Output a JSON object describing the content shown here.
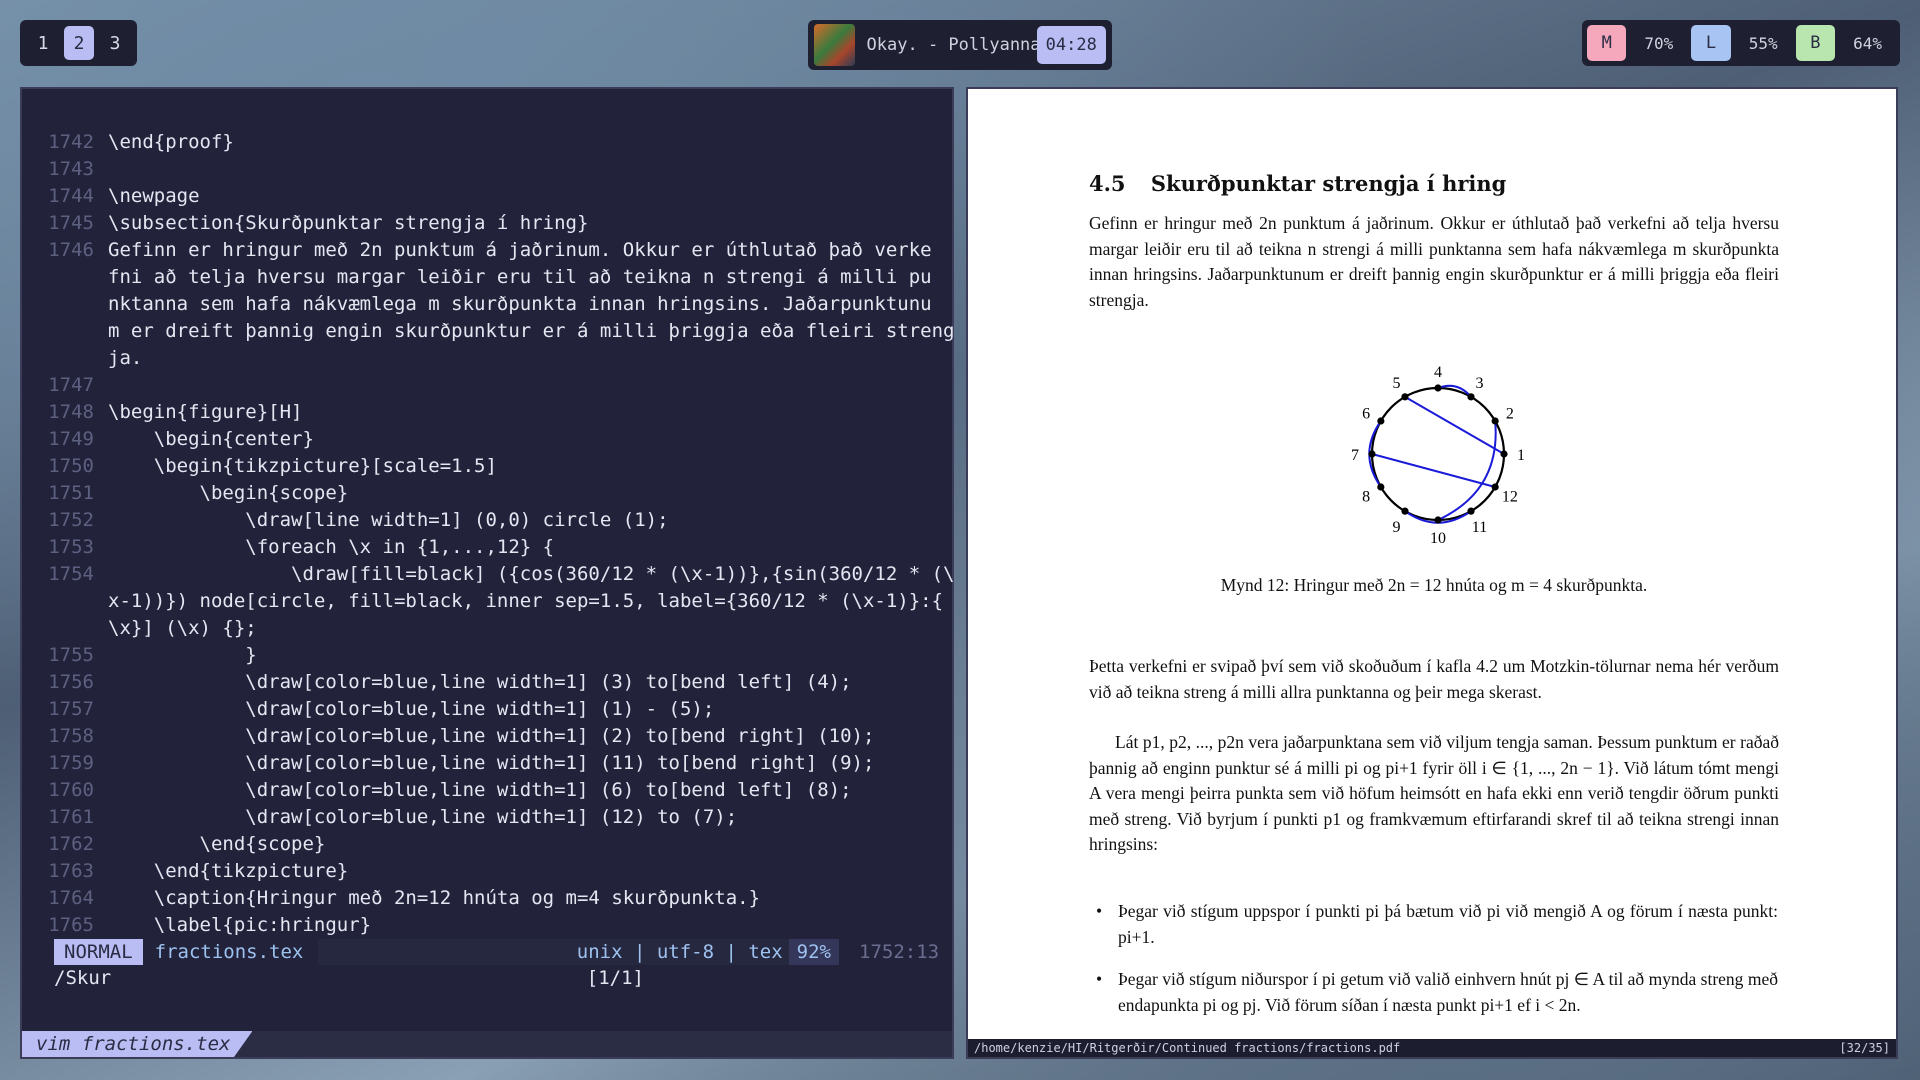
{
  "workspaces": [
    {
      "label": "1",
      "active": false
    },
    {
      "label": "2",
      "active": true
    },
    {
      "label": "3",
      "active": false
    }
  ],
  "player": {
    "track": "Okay. - Pollyanna",
    "time": "04:28"
  },
  "system": [
    {
      "key": "M",
      "value": "70%",
      "color": "#f5a8bc"
    },
    {
      "key": "L",
      "value": "55%",
      "color": "#a8c4f2"
    },
    {
      "key": "B",
      "value": "64%",
      "color": "#b9e6ae"
    }
  ],
  "editor": {
    "lines": [
      {
        "n": "1742",
        "t": "\\end{proof}"
      },
      {
        "n": "1743",
        "t": ""
      },
      {
        "n": "1744",
        "t": "\\newpage"
      },
      {
        "n": "1745",
        "t": "\\subsection{Skurðpunktar strengja í hring}"
      },
      {
        "n": "1746",
        "t": "Gefinn er hringur með 2n punktum á jaðrinum. Okkur er úthlutað það verke"
      },
      {
        "n": "",
        "t": "fni að telja hversu margar leiðir eru til að teikna n strengi á milli pu"
      },
      {
        "n": "",
        "t": "nktanna sem hafa nákvæmlega m skurðpunkta innan hringsins. Jaðarpunktunu"
      },
      {
        "n": "",
        "t": "m er dreift þannig engin skurðpunktur er á milli þriggja eða fleiri streng"
      },
      {
        "n": "",
        "t": "ja."
      },
      {
        "n": "1747",
        "t": ""
      },
      {
        "n": "1748",
        "t": "\\begin{figure}[H]"
      },
      {
        "n": "1749",
        "t": "    \\begin{center}"
      },
      {
        "n": "1750",
        "t": "    \\begin{tikzpicture}[scale=1.5]"
      },
      {
        "n": "1751",
        "t": "        \\begin{scope}"
      },
      {
        "n": "1752",
        "t": "            \\draw[line width=1] (0,0) circle (1);"
      },
      {
        "n": "1753",
        "t": "            \\foreach \\x in {1,...,12} {"
      },
      {
        "n": "1754",
        "t": "                \\draw[fill=black] ({cos(360/12 * (\\x-1))},{sin(360/12 * (\\"
      },
      {
        "n": "",
        "t": "x-1))}) node[circle, fill=black, inner sep=1.5, label={360/12 * (\\x-1)}:{"
      },
      {
        "n": "",
        "t": "\\x}] (\\x) {};"
      },
      {
        "n": "1755",
        "t": "            }"
      },
      {
        "n": "1756",
        "t": "            \\draw[color=blue,line width=1] (3) to[bend left] (4);"
      },
      {
        "n": "1757",
        "t": "            \\draw[color=blue,line width=1] (1) - (5);"
      },
      {
        "n": "1758",
        "t": "            \\draw[color=blue,line width=1] (2) to[bend right] (10);"
      },
      {
        "n": "1759",
        "t": "            \\draw[color=blue,line width=1] (11) to[bend right] (9);"
      },
      {
        "n": "1760",
        "t": "            \\draw[color=blue,line width=1] (6) to[bend left] (8);"
      },
      {
        "n": "1761",
        "t": "            \\draw[color=blue,line width=1] (12) to (7);"
      },
      {
        "n": "1762",
        "t": "        \\end{scope}"
      },
      {
        "n": "1763",
        "t": "    \\end{tikzpicture}"
      },
      {
        "n": "1764",
        "t": "    \\caption{Hringur með 2n=12 hnúta og m=4 skurðpunkta.}"
      },
      {
        "n": "1765",
        "t": "    \\label{pic:hringur}"
      }
    ],
    "status": {
      "mode": "NORMAL",
      "file": "fractions.tex",
      "format": "unix | utf-8 | tex",
      "percent": "92%",
      "position": "1752:13"
    },
    "cmdline": {
      "command": "/Skur",
      "match": "[1/1]"
    },
    "terminal_tab": "vim fractions.tex"
  },
  "pdf": {
    "section_number": "4.5",
    "section_title": "Skurðpunktar strengja í hring",
    "para1": "Gefinn er hringur með 2n punktum á jaðrinum. Okkur er úthlutað það verkefni að telja hversu margar leiðir eru til að teikna n strengi á milli punktanna sem hafa nákvæmlega m skurðpunkta innan hringsins. Jaðarpunktunum er dreift þannig engin skurðpunktur er á milli þriggja eða fleiri strengja.",
    "figure_labels": [
      "1",
      "2",
      "3",
      "4",
      "5",
      "6",
      "7",
      "8",
      "9",
      "10",
      "11",
      "12"
    ],
    "caption": "Mynd 12: Hringur með 2n = 12 hnúta og m = 4 skurðpunkta.",
    "para2": "Þetta verkefni er svipað því sem við skoðuðum í kafla 4.2 um Motzkin-tölurnar nema hér verðum við að teikna streng á milli allra punktanna og þeir mega skerast.",
    "para3": "Lát p1, p2, ..., p2n vera jaðarpunktana sem við viljum tengja saman. Þessum punktum er raðað þannig að enginn punktur sé á milli pi og pi+1 fyrir öll i ∈ {1, ..., 2n − 1}. Við látum tómt mengi A vera mengi þeirra punkta sem við höfum heimsótt en hafa ekki enn verið tengdir öðrum punkti með streng. Við byrjum í punkti p1 og framkvæmum eftirfarandi skref til að teikna strengi innan hringsins:",
    "bullet1": "Þegar við stígum uppspor í punkti pi þá bætum við pi við mengið A og förum í næsta punkt: pi+1.",
    "bullet2": "Þegar við stígum niðurspor í pi getum við valið einhvern hnút pj ∈ A til að mynda streng með endapunkta pi og pj. Við förum síðan í næsta punkt pi+1 ef i < 2n.",
    "status_path": "/home/kenzie/HI/Ritgerðir/Continued fractions/fractions.pdf",
    "status_page": "[32/35]"
  }
}
